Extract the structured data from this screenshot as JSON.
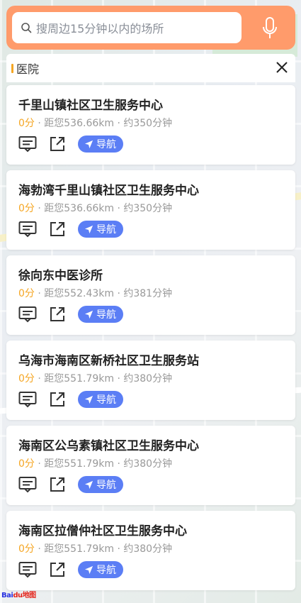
{
  "search": {
    "placeholder": "搜周边15分钟以内的场所"
  },
  "category": {
    "label": "医院"
  },
  "results": [
    {
      "name": "千里山镇社区卫生服务中心",
      "score": "0分",
      "distance": "· 距您536.66km",
      "time": "· 约350分钟",
      "nav_label": "导航"
    },
    {
      "name": "海勃湾千里山镇社区卫生服务中心",
      "score": "0分",
      "distance": "· 距您536.66km",
      "time": "· 约350分钟",
      "nav_label": "导航"
    },
    {
      "name": "徐向东中医诊所",
      "score": "0分",
      "distance": "· 距您552.43km",
      "time": "· 约381分钟",
      "nav_label": "导航"
    },
    {
      "name": "乌海市海南区新桥社区卫生服务站",
      "score": "0分",
      "distance": "· 距您551.79km",
      "time": "· 约380分钟",
      "nav_label": "导航"
    },
    {
      "name": "海南区公乌素镇社区卫生服务中心",
      "score": "0分",
      "distance": "· 距您551.79km",
      "time": "· 约380分钟",
      "nav_label": "导航"
    },
    {
      "name": "海南区拉僧仲社区卫生服务中心",
      "score": "0分",
      "distance": "· 距您551.79km",
      "time": "· 约380分钟",
      "nav_label": "导航"
    }
  ],
  "logo": {
    "text_a": "Bai",
    "text_b": "du",
    "text_c": "地图"
  },
  "colors": {
    "header": "#ff9b6b",
    "nav": "#5b7ef5",
    "score": "#f5a623"
  },
  "icons": {
    "search": "search-icon",
    "mic": "microphone-icon",
    "close": "close-icon",
    "comment": "comment-icon",
    "share": "share-icon",
    "navigate": "navigation-arrow-icon"
  }
}
